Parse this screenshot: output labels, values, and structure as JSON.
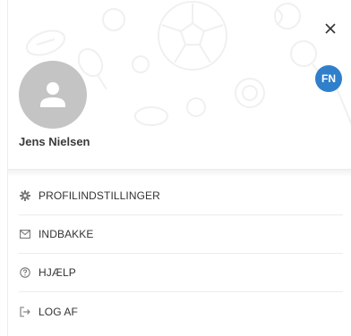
{
  "user": {
    "name": "Jens Nielsen",
    "initials": "FN",
    "badge_color": "#2f7fcb",
    "avatar_color": "#c4c4c4"
  },
  "header": {
    "close_icon": "close-icon"
  },
  "menu": {
    "items": [
      {
        "label": "PROFILINDSTILLINGER",
        "icon": "gear-icon"
      },
      {
        "label": "INDBAKKE",
        "icon": "mail-icon"
      },
      {
        "label": "HJÆLP",
        "icon": "help-icon"
      },
      {
        "label": "LOG AF",
        "icon": "logout-icon"
      }
    ]
  }
}
